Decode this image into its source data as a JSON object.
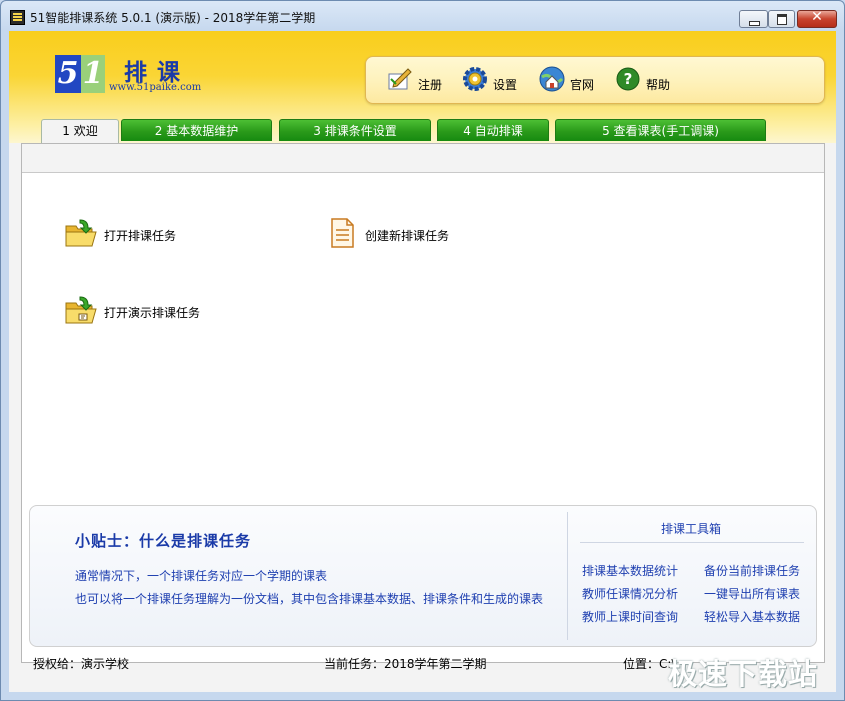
{
  "window": {
    "title": "51智能排课系统 5.0.1 (演示版) - 2018学年第二学期",
    "controls": {
      "close": "✕"
    }
  },
  "logo": {
    "digit_5": "5",
    "digit_1": "1",
    "text": "排课",
    "url": "www.51paike.com"
  },
  "toolbar": [
    {
      "label": "注册",
      "icon": "register-pen-icon"
    },
    {
      "label": "设置",
      "icon": "gear-settings-icon"
    },
    {
      "label": "官网",
      "icon": "home-globe-icon"
    },
    {
      "label": "帮助",
      "icon": "help-question-icon"
    }
  ],
  "tabs": [
    {
      "label": "1 欢迎",
      "active": true
    },
    {
      "label": "2 基本数据维护"
    },
    {
      "label": "3 排课条件设置"
    },
    {
      "label": "4 自动排课"
    },
    {
      "label": "5 查看课表(手工调课)"
    }
  ],
  "actions": {
    "open_task": "打开排课任务",
    "new_task": "创建新排课任务",
    "open_demo": "打开演示排课任务"
  },
  "tips": {
    "title": "小贴士：什么是排课任务",
    "line1": "通常情况下，一个排课任务对应一个学期的课表",
    "line2": "也可以将一个排课任务理解为一份文档，其中包含排课基本数据、排课条件和生成的课表"
  },
  "toolbox": {
    "title": "排课工具箱",
    "links": [
      "排课基本数据统计",
      "备份当前排课任务",
      "教师任课情况分析",
      "一键导出所有课表",
      "教师上课时间查询",
      "轻松导入基本数据"
    ]
  },
  "status": {
    "license": "授权给：演示学校",
    "current_task": "当前任务：2018学年第二学期",
    "location": "位置：C:\\"
  },
  "watermark": "极速下载站",
  "colors": {
    "accent_blue": "#1e3fb0",
    "tab_green": "#2a9a1a",
    "banner_yellow": "#f9ce1c"
  }
}
